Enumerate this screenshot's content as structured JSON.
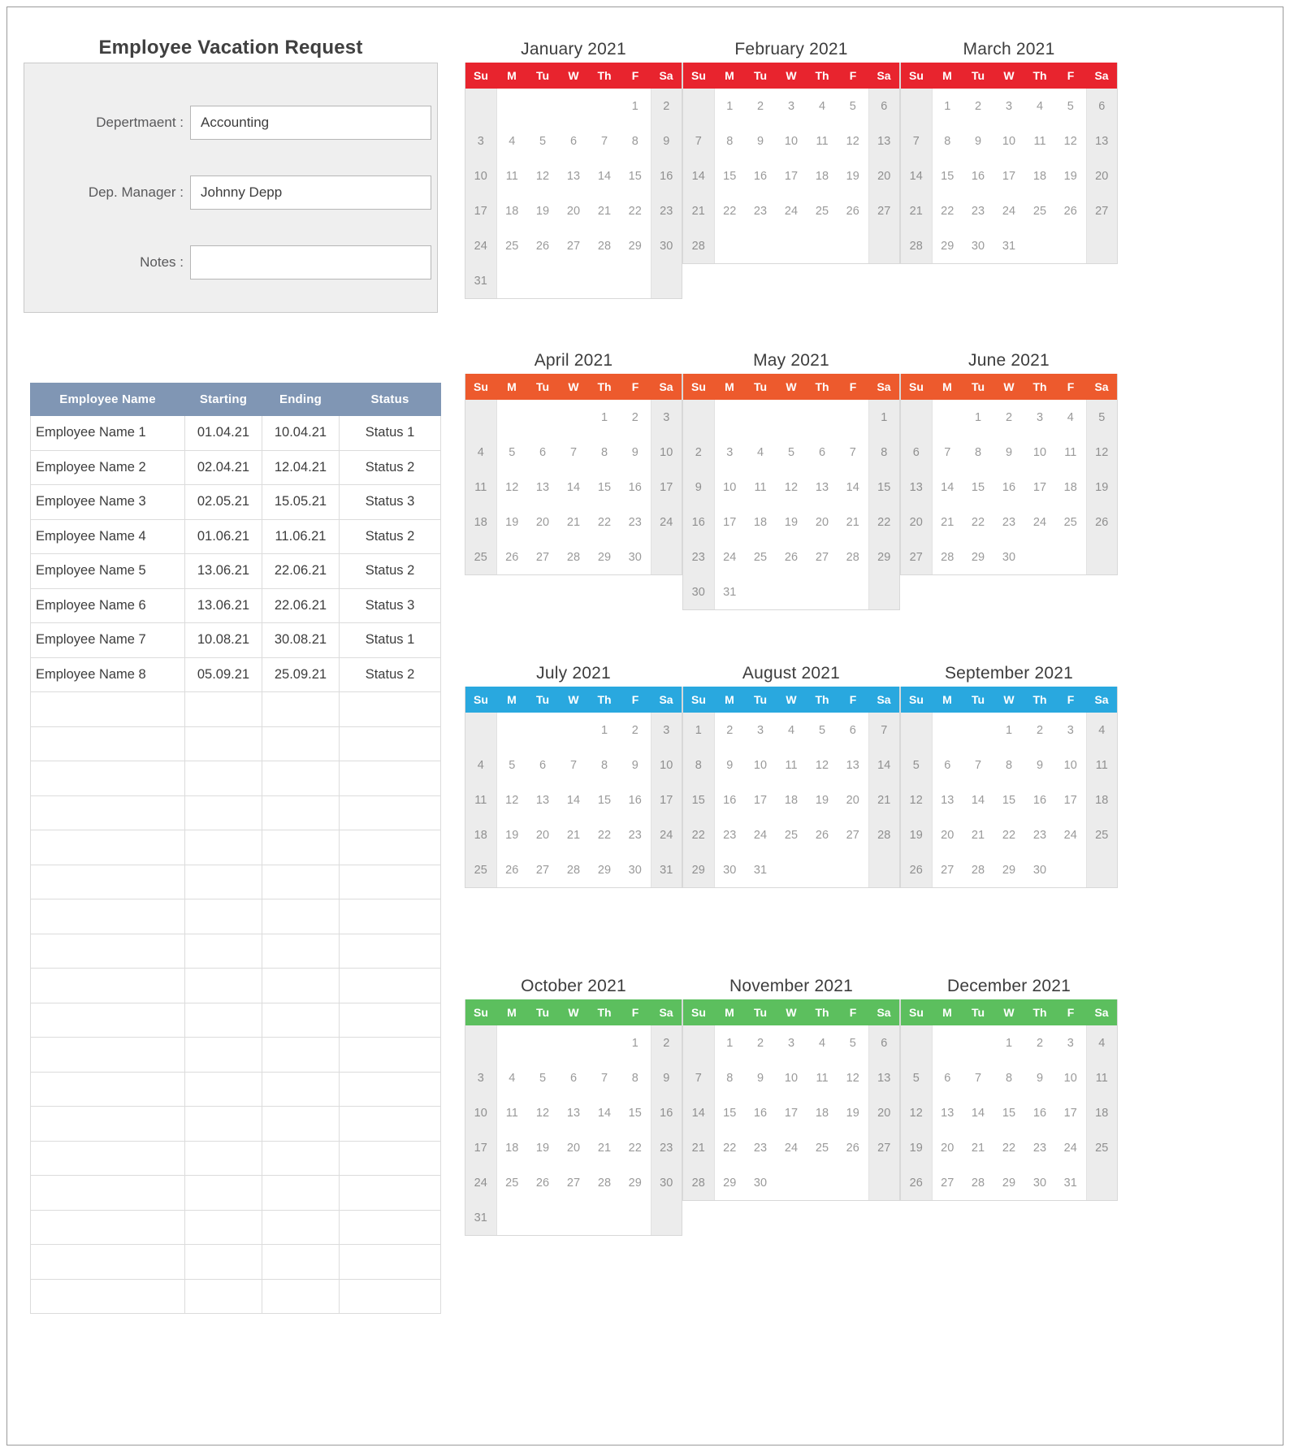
{
  "form": {
    "title": "Employee Vacation Request",
    "fields": [
      {
        "label": "Depertmaent :",
        "value": "Accounting",
        "placeholder": ""
      },
      {
        "label": "Dep. Manager :",
        "value": "Johnny Depp",
        "placeholder": ""
      },
      {
        "label": "Notes :",
        "value": "",
        "placeholder": ""
      }
    ]
  },
  "table": {
    "headers": [
      "Employee Name",
      "Starting",
      "Ending",
      "Status"
    ],
    "rows": [
      {
        "name": "Employee Name 1",
        "start": "01.04.21",
        "end": "10.04.21",
        "status": "Status 1"
      },
      {
        "name": "Employee Name 2",
        "start": "02.04.21",
        "end": "12.04.21",
        "status": "Status 2"
      },
      {
        "name": "Employee Name 3",
        "start": "02.05.21",
        "end": "15.05.21",
        "status": "Status 3"
      },
      {
        "name": "Employee Name 4",
        "start": "01.06.21",
        "end": "11.06.21",
        "status": "Status 2"
      },
      {
        "name": "Employee Name 5",
        "start": "13.06.21",
        "end": "22.06.21",
        "status": "Status 2"
      },
      {
        "name": "Employee Name 6",
        "start": "13.06.21",
        "end": "22.06.21",
        "status": "Status 3"
      },
      {
        "name": "Employee Name 7",
        "start": "10.08.21",
        "end": "30.08.21",
        "status": "Status 1"
      },
      {
        "name": "Employee Name 8",
        "start": "05.09.21",
        "end": "25.09.21",
        "status": "Status 2"
      }
    ],
    "empty_row_count": 18
  },
  "calendar": {
    "year": "2021",
    "weekdays": [
      "Su",
      "M",
      "Tu",
      "W",
      "Th",
      "F",
      "Sa"
    ],
    "quarter_colors": {
      "q1": "#e8242e",
      "q2": "#ed5a2d",
      "q3": "#29a8df",
      "q4": "#5cbf5e"
    },
    "months": [
      {
        "title": "January 2021",
        "quarter": "q1",
        "first_weekday": 5,
        "days": 31
      },
      {
        "title": "February 2021",
        "quarter": "q1",
        "first_weekday": 1,
        "days": 28
      },
      {
        "title": "March 2021",
        "quarter": "q1",
        "first_weekday": 1,
        "days": 31
      },
      {
        "title": "April 2021",
        "quarter": "q2",
        "first_weekday": 4,
        "days": 30
      },
      {
        "title": "May 2021",
        "quarter": "q2",
        "first_weekday": 6,
        "days": 31
      },
      {
        "title": "June 2021",
        "quarter": "q2",
        "first_weekday": 2,
        "days": 30
      },
      {
        "title": "July 2021",
        "quarter": "q3",
        "first_weekday": 4,
        "days": 31
      },
      {
        "title": "August 2021",
        "quarter": "q3",
        "first_weekday": 0,
        "days": 31
      },
      {
        "title": "September 2021",
        "quarter": "q3",
        "first_weekday": 3,
        "days": 30
      },
      {
        "title": "October 2021",
        "quarter": "q4",
        "first_weekday": 5,
        "days": 31
      },
      {
        "title": "November 2021",
        "quarter": "q4",
        "first_weekday": 1,
        "days": 30
      },
      {
        "title": "December 2021",
        "quarter": "q4",
        "first_weekday": 3,
        "days": 31
      }
    ]
  }
}
